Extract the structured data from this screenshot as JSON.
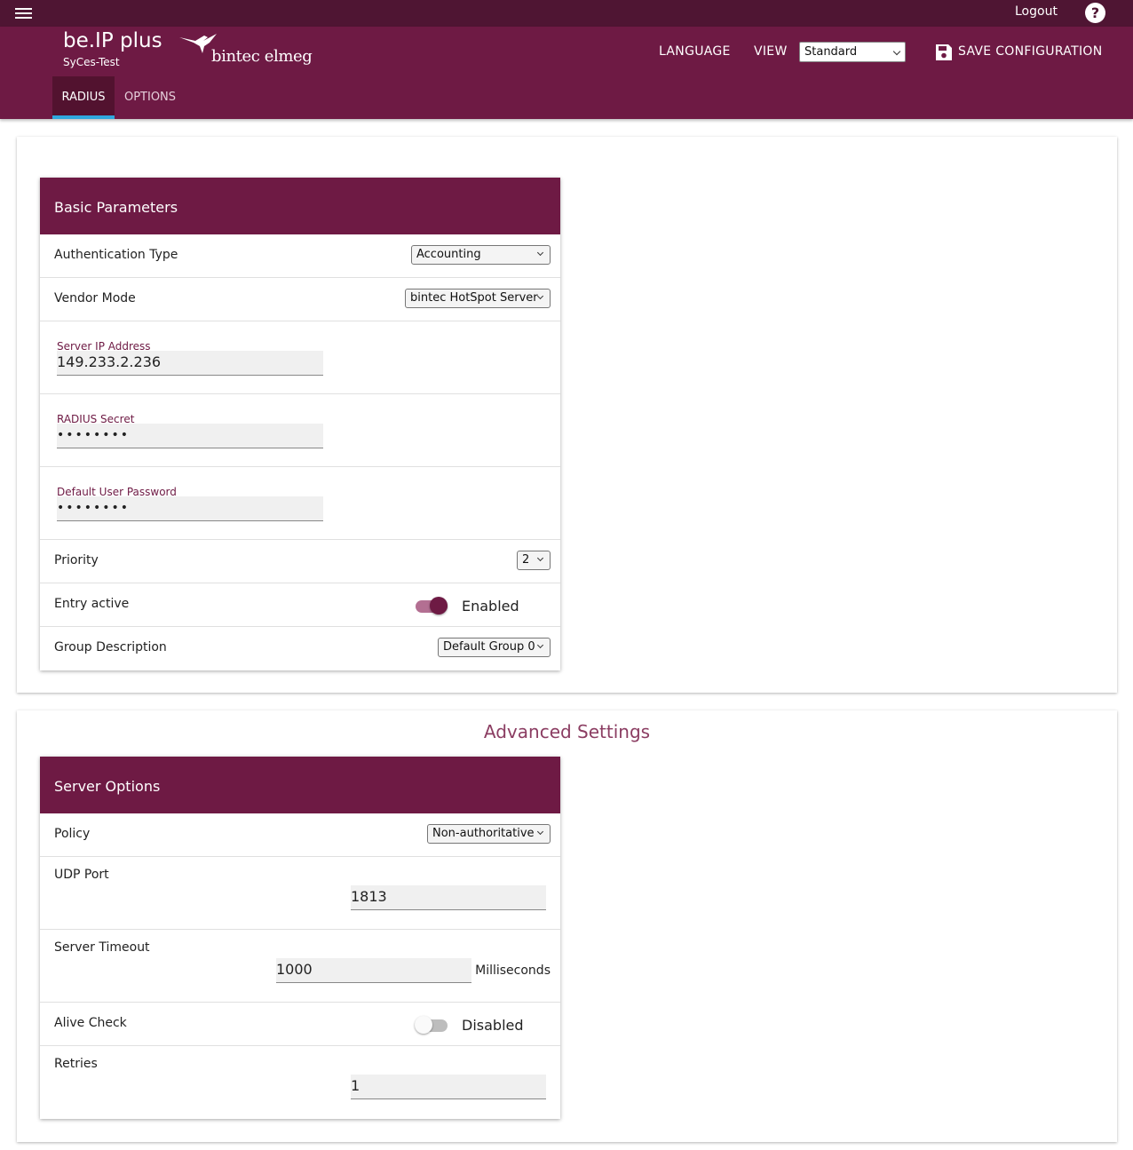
{
  "topbar": {
    "logout": "Logout",
    "help": "?"
  },
  "header": {
    "product": "be.IP plus",
    "device": "SyCes-Test",
    "brand": "bintec elmeg",
    "language_label": "LANGUAGE",
    "view_label": "VIEW",
    "view_value": "Standard",
    "save_label": "SAVE CONFIGURATION",
    "tabs": [
      {
        "label": "RADIUS",
        "active": true
      },
      {
        "label": "OPTIONS",
        "active": false
      }
    ]
  },
  "basic": {
    "title": "Basic Parameters",
    "auth_type": {
      "label": "Authentication Type",
      "value": "Accounting"
    },
    "vendor_mode": {
      "label": "Vendor Mode",
      "value": "bintec HotSpot Server"
    },
    "server_ip": {
      "label": "Server IP Address",
      "value": "149.233.2.236"
    },
    "radius_secret": {
      "label": "RADIUS Secret",
      "value": "••••••••"
    },
    "default_pw": {
      "label": "Default User Password",
      "value": "••••••••"
    },
    "priority": {
      "label": "Priority",
      "value": "2"
    },
    "entry_active": {
      "label": "Entry active",
      "state": "Enabled",
      "on": true
    },
    "group_desc": {
      "label": "Group Description",
      "value": "Default Group 0"
    }
  },
  "advanced": {
    "section_title": "Advanced Settings",
    "title": "Server Options",
    "policy": {
      "label": "Policy",
      "value": "Non-authoritative"
    },
    "udp_port": {
      "label": "UDP Port",
      "value": "1813"
    },
    "server_timeout": {
      "label": "Server Timeout",
      "value": "1000",
      "unit": "Milliseconds"
    },
    "alive_check": {
      "label": "Alive Check",
      "state": "Disabled",
      "on": false
    },
    "retries": {
      "label": "Retries",
      "value": "1"
    }
  },
  "colors": {
    "primary": "#6e1a44",
    "topbar": "#4f1533",
    "tab_indicator": "#2fa8dd"
  }
}
